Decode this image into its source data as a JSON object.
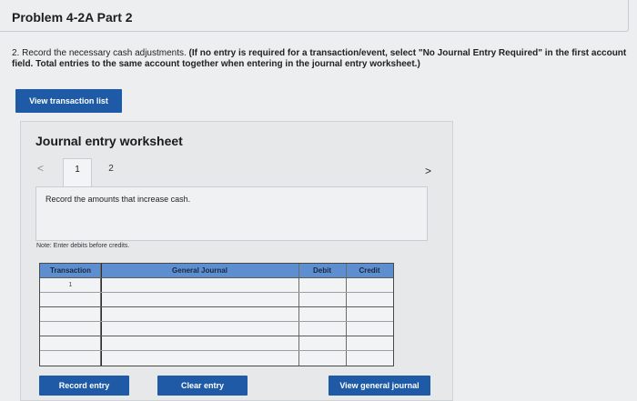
{
  "header": {
    "title": "Problem 4-2A Part 2"
  },
  "instructions": {
    "lead": "2. Record the necessary cash adjustments.",
    "bold": "(If no entry is required for a transaction/event, select \"No Journal Entry Required\" in the first account field. Total entries to the same account together when entering in the journal entry worksheet.)"
  },
  "buttons": {
    "view_transaction_list": "View transaction list",
    "record_entry": "Record entry",
    "clear_entry": "Clear entry",
    "view_general_journal": "View general journal"
  },
  "worksheet": {
    "title": "Journal entry worksheet",
    "prev_icon": "chevron-left-icon",
    "next_icon": "chevron-right-icon",
    "prev_glyph": "<",
    "next_glyph": ">",
    "tabs": [
      "1",
      "2"
    ],
    "active_tab": "1",
    "description": "Record the amounts that increase cash.",
    "note": "Note: Enter debits before credits."
  },
  "journal_table": {
    "columns": [
      "Transaction",
      "General Journal",
      "Debit",
      "Credit"
    ],
    "rows": [
      {
        "transaction": "1",
        "account": "",
        "debit": "",
        "credit": ""
      },
      {
        "transaction": "",
        "account": "",
        "debit": "",
        "credit": ""
      },
      {
        "transaction": "",
        "account": "",
        "debit": "",
        "credit": ""
      },
      {
        "transaction": "",
        "account": "",
        "debit": "",
        "credit": ""
      },
      {
        "transaction": "",
        "account": "",
        "debit": "",
        "credit": ""
      },
      {
        "transaction": "",
        "account": "",
        "debit": "",
        "credit": ""
      }
    ]
  },
  "colors": {
    "primary_button": "#1e5aa6",
    "table_header": "#5d8fd0"
  }
}
